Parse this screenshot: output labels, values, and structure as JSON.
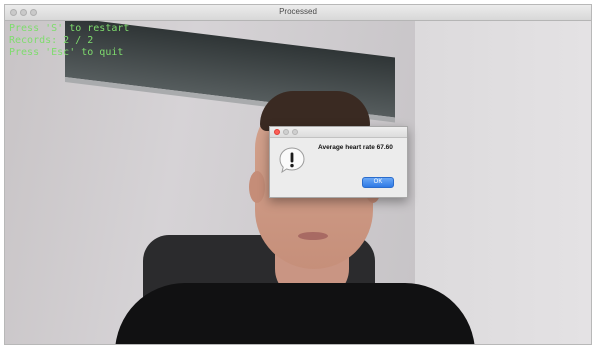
{
  "window": {
    "title": "Processed"
  },
  "overlay": {
    "lines": [
      "Press 'S' to restart",
      "Records: 2 / 2",
      "Press 'Esc' to quit"
    ],
    "color": "#7fdc6e"
  },
  "dialog": {
    "message": "Average heart rate 67.60",
    "ok_label": "OK",
    "icon": "alert-icon"
  },
  "colors": {
    "ok_button": "#2f7ae5",
    "close_button": "#fc5f57"
  }
}
